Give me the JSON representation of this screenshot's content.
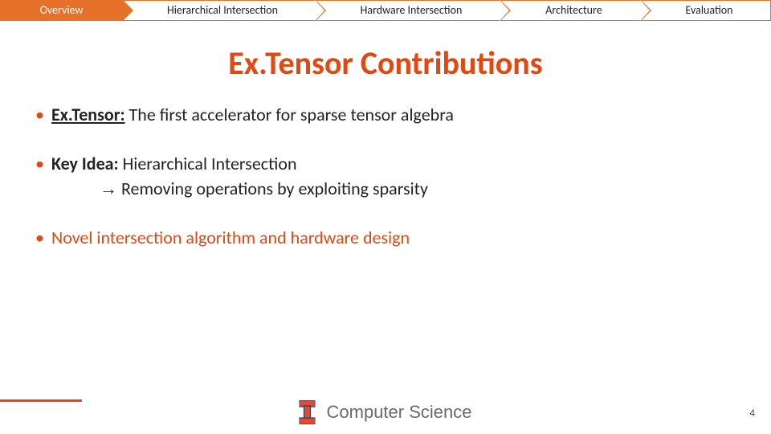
{
  "nav": {
    "items": [
      {
        "label": "Overview",
        "active": true
      },
      {
        "label": "Hierarchical Intersection",
        "active": false
      },
      {
        "label": "Hardware Intersection",
        "active": false
      },
      {
        "label": "Architecture",
        "active": false
      },
      {
        "label": "Evaluation",
        "active": false
      }
    ]
  },
  "title": "Ex.Tensor Contributions",
  "bullets": {
    "b1_prefix": "Ex.Tensor:",
    "b1_rest": " The first accelerator for sparse tensor algebra",
    "b2_prefix": "Key Idea: ",
    "b2_rest": "Hierarchical Intersection",
    "b2_sub_arrow": "→",
    "b2_sub_text": " Removing operations by exploiting sparsity",
    "b3": "Novel intersection algorithm and hardware design"
  },
  "footer": {
    "dept": "Computer Science",
    "page": "4"
  },
  "colors": {
    "accent": "#e24912",
    "nav_border": "#e57228"
  }
}
